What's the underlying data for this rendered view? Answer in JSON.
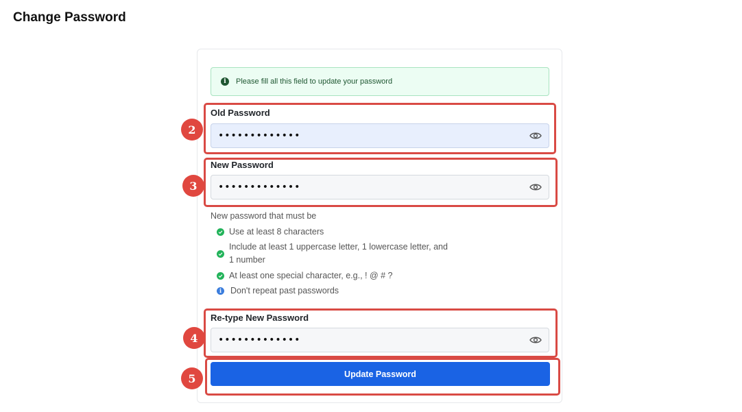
{
  "page": {
    "title": "Change Password"
  },
  "alert": {
    "text": "Please fill all this field to update your password",
    "icon": "info-circle-icon"
  },
  "fields": [
    {
      "label": "Old Password",
      "value": "•••••••••••••",
      "icon": "eye-icon",
      "step": "2"
    },
    {
      "label": "New Password",
      "value": "•••••••••••••",
      "icon": "eye-icon",
      "step": "3"
    },
    {
      "label": "Re-type New Password",
      "value": "•••••••••••••",
      "icon": "eye-icon",
      "step": "4"
    }
  ],
  "requirements": {
    "intro": "New password that must be",
    "items": [
      {
        "text": "Use at least 8 characters",
        "status": "met"
      },
      {
        "text": "Include at least 1 uppercase letter, 1 lowercase letter, and 1 number",
        "status": "met"
      },
      {
        "text": "At least one special character, e.g., ! @ # ?",
        "status": "met"
      },
      {
        "text": "Don't repeat past passwords",
        "status": "info"
      }
    ]
  },
  "submit": {
    "label": "Update Password",
    "step": "5"
  },
  "colors": {
    "primary": "#1a63e4",
    "success": "#22b35a",
    "info": "#3b7ddd",
    "highlight": "#d94a44",
    "alert_bg": "#ecfdf3"
  }
}
